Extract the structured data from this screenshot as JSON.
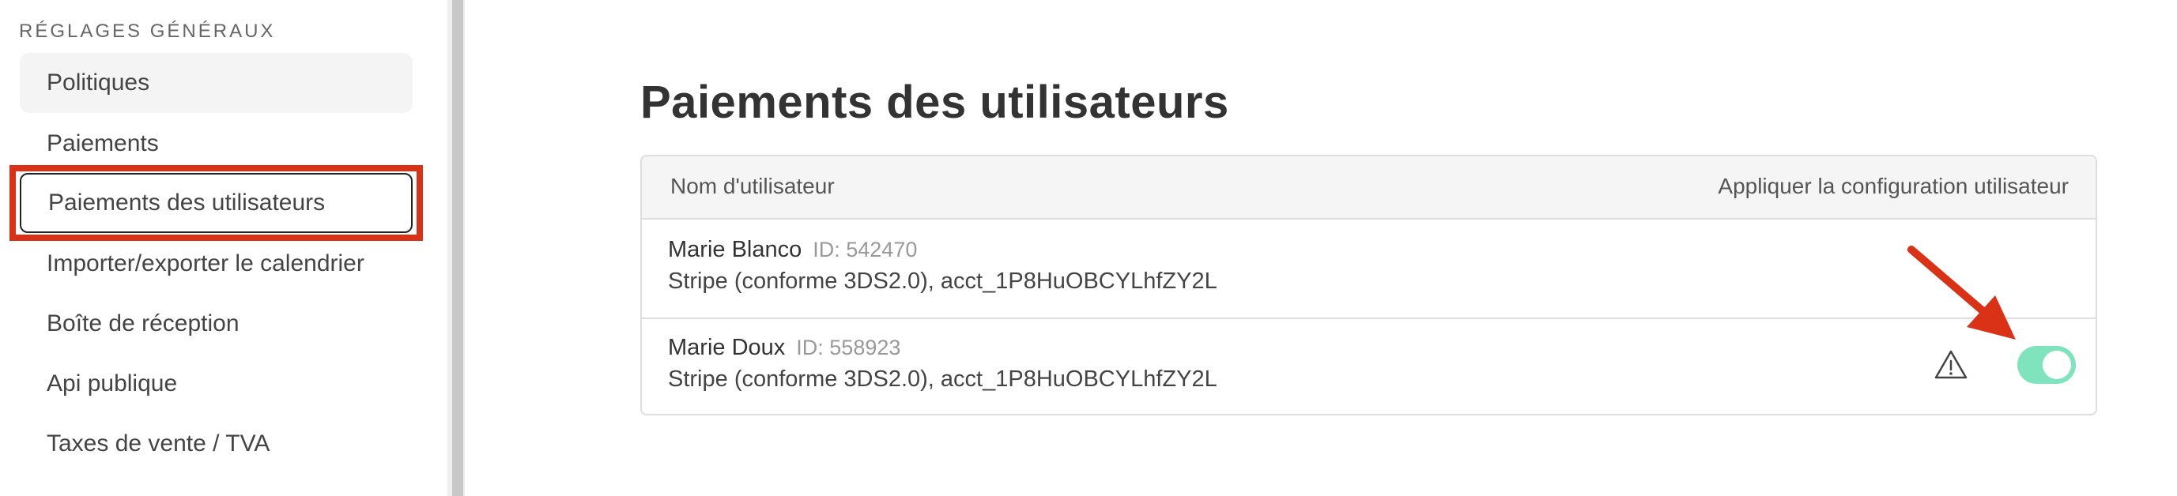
{
  "sidebar": {
    "section_title": "RÉGLAGES GÉNÉRAUX",
    "items": [
      {
        "label": "Politiques"
      },
      {
        "label": "Paiements"
      },
      {
        "label": "Paiements des utilisateurs"
      },
      {
        "label": "Importer/exporter le calendrier"
      },
      {
        "label": "Boîte de réception"
      },
      {
        "label": "Api publique"
      },
      {
        "label": "Taxes de vente / TVA"
      }
    ],
    "active_item": "Paiements des utilisateurs"
  },
  "main": {
    "title": "Paiements des utilisateurs",
    "table": {
      "columns": [
        "Nom d'utilisateur",
        "Appliquer la configuration utilisateur"
      ],
      "rows": [
        {
          "name": "Marie Blanco",
          "id": "ID: 542470",
          "account": "Stripe (conforme 3DS2.0), acct_1P8HuOBCYLhfZY2L",
          "has_warning": false,
          "toggle_on": null
        },
        {
          "name": "Marie Doux",
          "id": "ID: 558923",
          "account": "Stripe (conforme 3DS2.0), acct_1P8HuOBCYLhfZY2L",
          "has_warning": true,
          "toggle_on": true
        }
      ]
    }
  },
  "icons": {
    "warning": "warning-triangle-icon",
    "annotation": "red-arrow-icon"
  },
  "colors": {
    "highlight_border": "#d93217",
    "toggle_on": "#7fe3bd",
    "arrow": "#d93217"
  }
}
